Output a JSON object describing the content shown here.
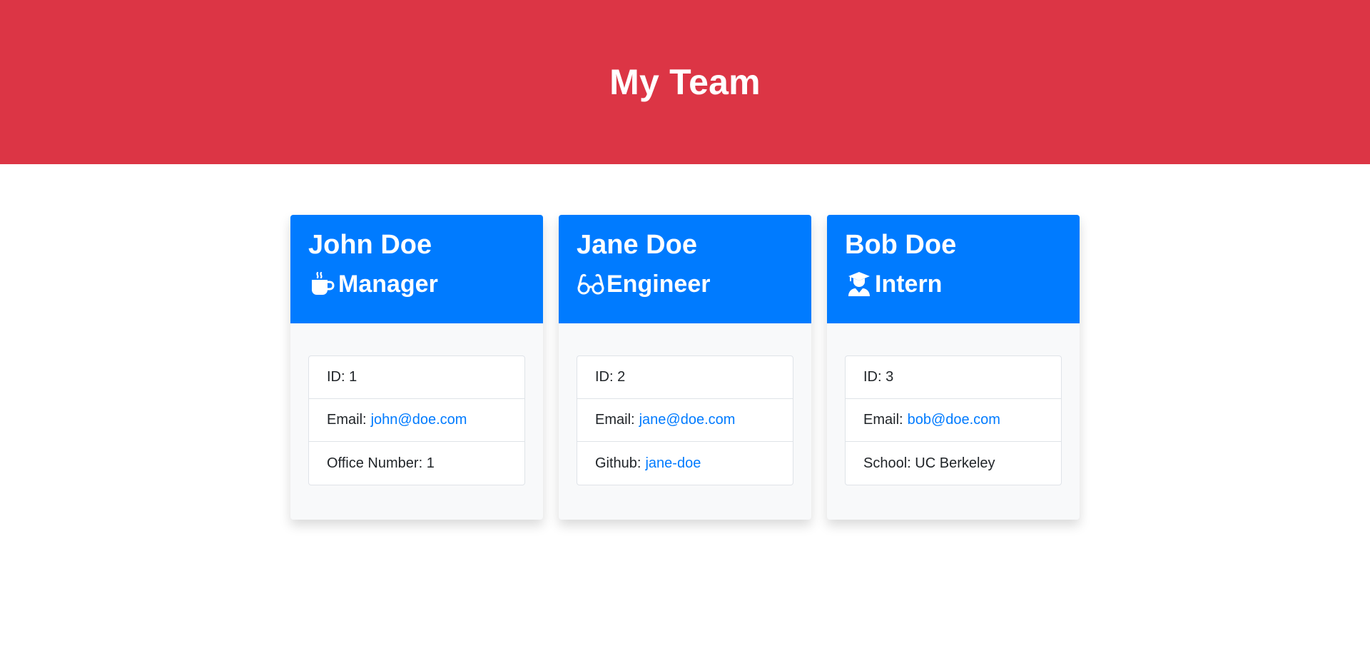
{
  "header": {
    "title": "My Team"
  },
  "team": [
    {
      "name": "John Doe",
      "role": "Manager",
      "role_icon": "coffee-mug-icon",
      "id_label": "ID:",
      "id": "1",
      "email_label": "Email:",
      "email": "john@doe.com",
      "extra_label": "Office Number:",
      "extra_value": "1"
    },
    {
      "name": "Jane Doe",
      "role": "Engineer",
      "role_icon": "glasses-icon",
      "id_label": "ID:",
      "id": "2",
      "email_label": "Email:",
      "email": "jane@doe.com",
      "extra_label": "Github:",
      "extra_value": "jane-doe"
    },
    {
      "name": "Bob Doe",
      "role": "Intern",
      "role_icon": "graduate-icon",
      "id_label": "ID:",
      "id": "3",
      "email_label": "Email:",
      "email": "bob@doe.com",
      "extra_label": "School:",
      "extra_value": "UC Berkeley"
    }
  ],
  "colors": {
    "header_bg": "#dc3545",
    "card_header_bg": "#007bff",
    "link": "#007bff"
  }
}
